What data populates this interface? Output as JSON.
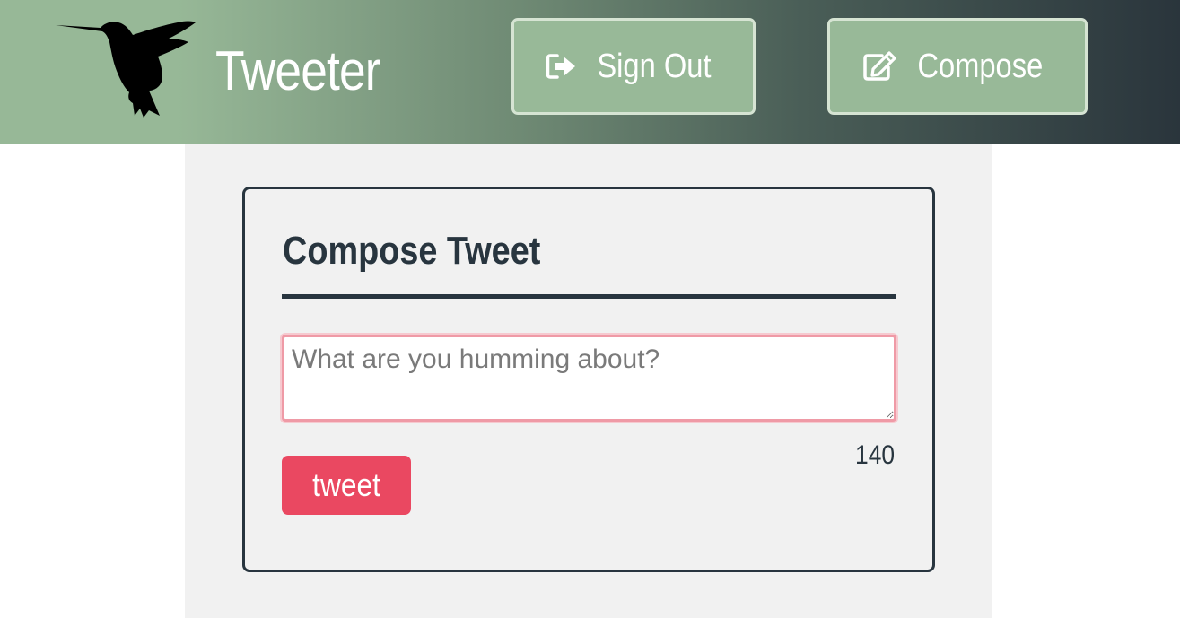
{
  "nav": {
    "brand": "Tweeter",
    "logo_icon": "hummingbird-icon",
    "signout": {
      "label": "Sign Out",
      "icon": "sign-out-icon"
    },
    "compose": {
      "label": "Compose",
      "icon": "edit-icon"
    },
    "colors": {
      "gradient_start": "#97b897",
      "gradient_end": "#2a353c",
      "button_bg": "#98b998"
    }
  },
  "composer": {
    "title": "Compose Tweet",
    "placeholder": "What are you humming about?",
    "value": "",
    "counter": "140",
    "submit_label": "tweet",
    "colors": {
      "accent": "#ea4861",
      "text": "#28353f",
      "panel_bg": "#f1f1f1"
    }
  }
}
